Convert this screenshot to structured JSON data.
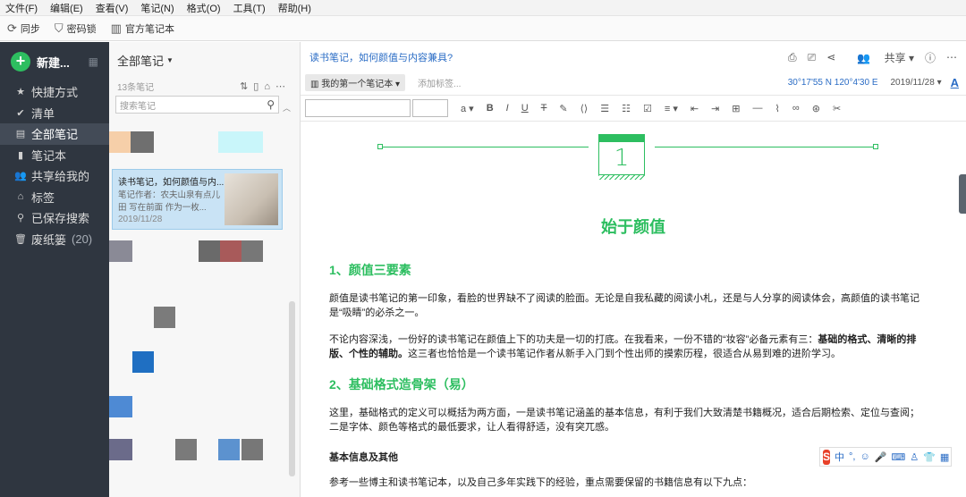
{
  "menubar": [
    "文件(F)",
    "编辑(E)",
    "查看(V)",
    "笔记(N)",
    "格式(O)",
    "工具(T)",
    "帮助(H)"
  ],
  "toolbar": {
    "sync": "同步",
    "lock": "密码锁",
    "official": "官方笔记本"
  },
  "sidebar": {
    "new_label": "新建...",
    "items": [
      {
        "label": "快捷方式",
        "icon": "star-icon"
      },
      {
        "label": "清单",
        "icon": "check-circle-icon"
      },
      {
        "label": "全部笔记",
        "icon": "note-icon",
        "active": true
      },
      {
        "label": "笔记本",
        "icon": "notebook-icon"
      },
      {
        "label": "共享给我的",
        "icon": "users-icon"
      },
      {
        "label": "标签",
        "icon": "tag-icon"
      },
      {
        "label": "已保存搜索",
        "icon": "search-icon"
      },
      {
        "label": "废纸篓",
        "icon": "trash-icon",
        "count": "(20)"
      }
    ]
  },
  "list": {
    "title": "全部笔记",
    "count": "13条笔记",
    "search_placeholder": "搜索笔记",
    "selected_note": {
      "title": "读书笔记，如何颜值与内...",
      "preview": "笔记作者：农夫山泉有点儿田 写在前面 作为一枚...",
      "date": "2019/11/28"
    }
  },
  "editor": {
    "title": "读书笔记，如何颜值与内容兼具?",
    "share": "共享",
    "notebook": "我的第一个笔记本",
    "tag_placeholder": "添加标签...",
    "coords": "30°17'55 N  120°4'30 E",
    "date": "2019/11/28",
    "calendar_day": "1",
    "heading_main": "始于颜值",
    "section1": "1、颜值三要素",
    "para1": "颜值是读书笔记的第一印象，看脸的世界缺不了阅读的脸面。无论是自我私藏的阅读小札，还是与人分享的阅读体会，高颜值的读书笔记是“吸睛”的必杀之一。",
    "para2_a": "不论内容深浅，一份好的读书笔记在颜值上下的功夫是一切的打底。在我看来，一份不错的“妆容”必备元素有三：",
    "para2_b": "基础的格式、清晰的排版、个性的辅助。",
    "para2_c": "这三者也恰恰是一个读书笔记作者从新手入门到个性出师的摸索历程，很适合从易到难的进阶学习。",
    "section2": "2、基础格式造骨架（易）",
    "para3": "这里，基础格式的定义可以概括为两方面，一是读书笔记涵盖的基本信息，有利于我们大致清楚书籍概况，适合后期检索、定位与查阅；二是字体、颜色等格式的最低要求，让人看得舒适，没有突兀感。",
    "sub_heading": "基本信息及其他",
    "para4": "参考一些博主和读书笔记本，以及自己多年实践下的经验，重点需要保留的书籍信息有以下九点："
  },
  "ime": {
    "lang": "中"
  }
}
